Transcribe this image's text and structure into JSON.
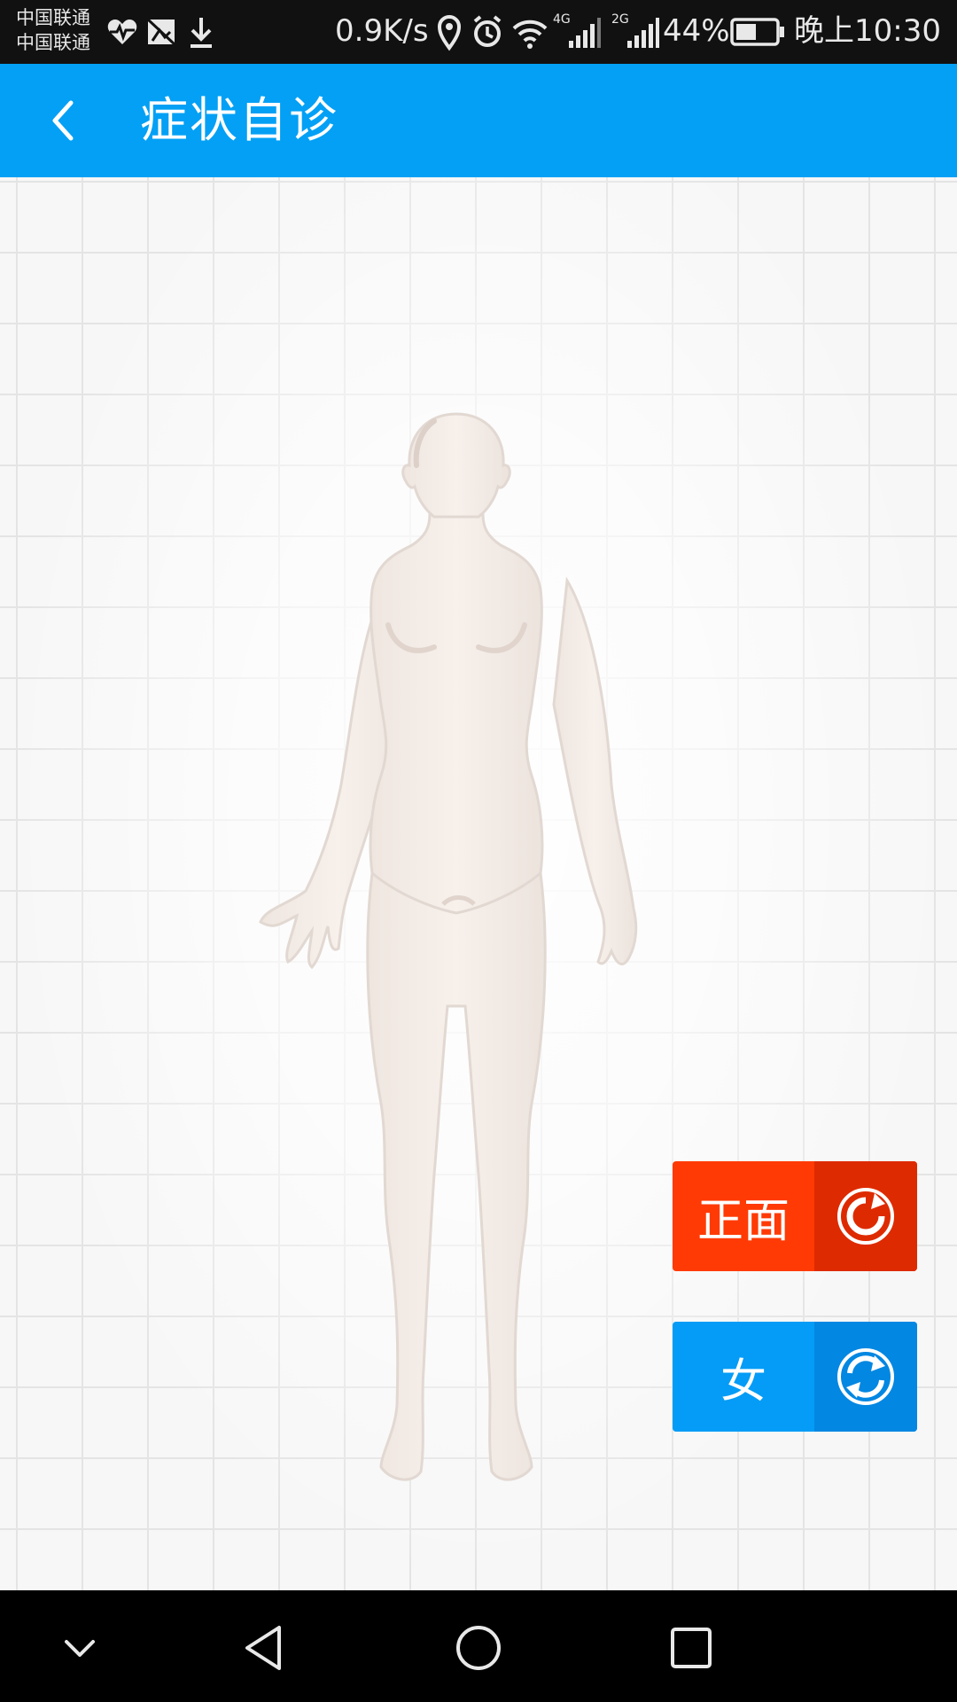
{
  "status_bar": {
    "carrier_1": "中国联通",
    "carrier_2": "中国联通",
    "network_speed": "0.9K/s",
    "network_1": "4G",
    "network_2": "2G",
    "battery": "44%",
    "time": "晚上10:30"
  },
  "app_bar": {
    "title": "症状自诊"
  },
  "controls": {
    "view_label": "正面",
    "gender_label": "女"
  },
  "colors": {
    "app_bar": "#03a0f5",
    "view_button": "#ff3a04",
    "gender_button": "#049cf6",
    "figure_skin": "#f6efeb"
  }
}
